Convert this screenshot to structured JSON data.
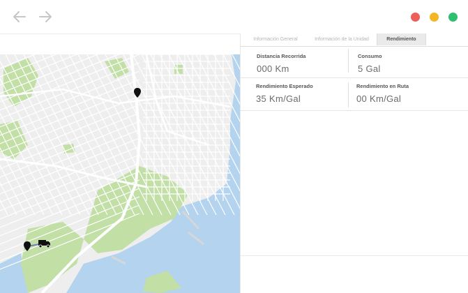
{
  "window": {
    "icons": {
      "back": "arrow-left-icon",
      "forward": "arrow-right-icon"
    },
    "controls": {
      "close": "#ee5f5b",
      "minimize": "#f5b625",
      "maximize": "#2fbf6e"
    }
  },
  "tabs": [
    {
      "label": "Información General",
      "active": false
    },
    {
      "label": "Información de la Unidad",
      "active": false
    },
    {
      "label": "Rendimiento",
      "active": true
    }
  ],
  "metrics": {
    "distancia": {
      "label": "Distancia Recorrida",
      "value": "000  Km"
    },
    "consumo": {
      "label": "Consumo",
      "value": "5 Gal"
    },
    "esperado": {
      "label": "Rendimiento Esperado",
      "value": "35 Km/Gal"
    },
    "ruta": {
      "label": "Rendimiento en Ruta",
      "value": "00  Km/Gal"
    }
  },
  "map": {
    "colors": {
      "land": "#eeeeee",
      "water": "#b3d3ee",
      "park": "#c2dfa6",
      "road": "#ffffff",
      "route": "#6f7fb8",
      "marker": "#111111"
    },
    "icons": [
      "map-pin-icon",
      "map-pin-icon",
      "truck-icon"
    ]
  }
}
